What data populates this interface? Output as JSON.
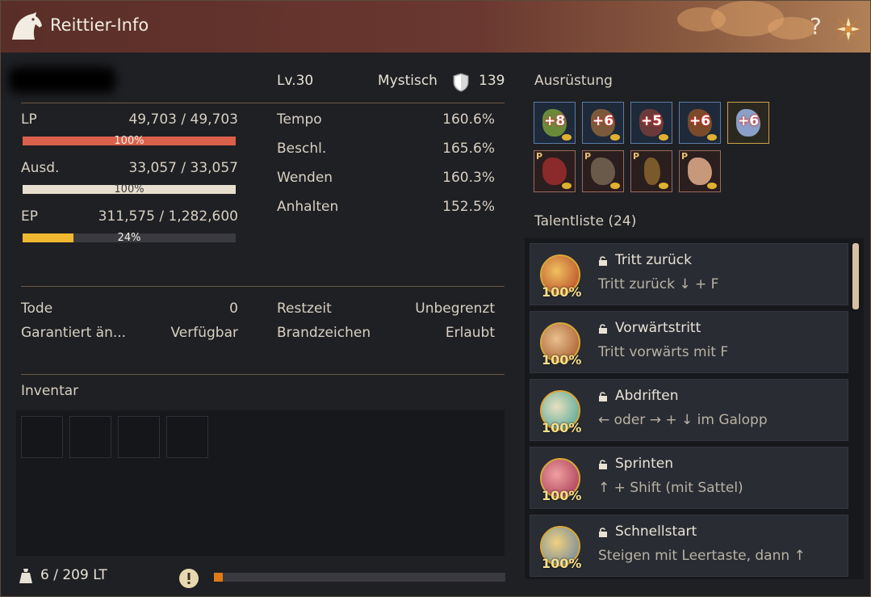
{
  "window": {
    "title": "Reittier-Info",
    "help_label": "?"
  },
  "mount": {
    "level": "Lv.30",
    "grade": "Mystisch",
    "power": "139"
  },
  "vitals": {
    "lp": {
      "label": "LP",
      "value": "49,703 / 49,703",
      "percent_text": "100%",
      "fill": 1.0
    },
    "stamina": {
      "label": "Ausd.",
      "value": "33,057 / 33,057",
      "percent_text": "100%",
      "fill": 1.0
    },
    "ep": {
      "label": "EP",
      "value": "311,575 / 1,282,600",
      "percent_text": "24%",
      "fill": 0.24
    }
  },
  "stats": [
    {
      "label": "Tempo",
      "value": "160.6%"
    },
    {
      "label": "Beschl.",
      "value": "165.6%"
    },
    {
      "label": "Wenden",
      "value": "160.3%"
    },
    {
      "label": "Anhalten",
      "value": "152.5%"
    }
  ],
  "info": {
    "deaths_label": "Tode",
    "deaths_value": "0",
    "guaranteed_label": "Garantiert än...",
    "guaranteed_value": "Verfügbar",
    "remaining_label": "Restzeit",
    "remaining_value": "Unbegrenzt",
    "brand_label": "Brandzeichen",
    "brand_value": "Erlaubt"
  },
  "inventory": {
    "label": "Inventar",
    "weight": "6 / 209 LT",
    "weight_fill": 0.03
  },
  "equipment": {
    "label": "Ausrüstung",
    "gear": [
      {
        "enhance": "+8",
        "color": "#6a8a3a"
      },
      {
        "enhance": "+6",
        "color": "#7a5a3a"
      },
      {
        "enhance": "+5",
        "color": "#6a3a3a"
      },
      {
        "enhance": "+6",
        "color": "#7a4a2a"
      },
      {
        "enhance": "+6",
        "color": "#8aa0c8"
      }
    ],
    "pets_marker": "P"
  },
  "talents": {
    "label": "Talentliste (24)",
    "items": [
      {
        "name": "Tritt zurück",
        "desc": "Tritt zurück ↓ + F",
        "pct": "100%"
      },
      {
        "name": "Vorwärtstritt",
        "desc": "Tritt vorwärts mit F",
        "pct": "100%"
      },
      {
        "name": "Abdriften",
        "desc": "← oder → + ↓ im Galopp",
        "pct": "100%"
      },
      {
        "name": "Sprinten",
        "desc": "↑ + Shift (mit Sattel)",
        "pct": "100%"
      },
      {
        "name": "Schnellstart",
        "desc": "Steigen mit Leertaste, dann ↑",
        "pct": "100%"
      }
    ]
  },
  "colors": {
    "lp_bar": "#d9604a",
    "stamina_bar": "#e6dfcf",
    "ep_bar": "#f0b830",
    "weight_bar": "#e07a18"
  }
}
